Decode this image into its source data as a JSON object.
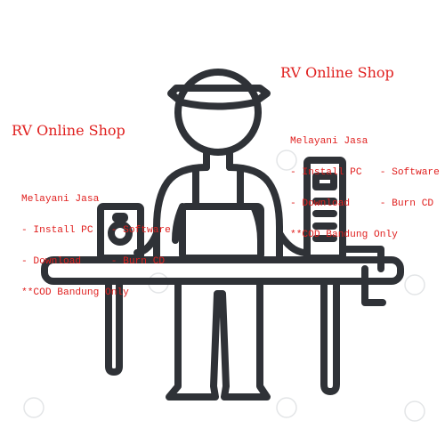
{
  "illustration": {
    "subject": "person-at-desk-icon",
    "stroke_color": "#2f3237",
    "background_color": "#ffffff"
  },
  "ads": [
    {
      "title": "RV Online Shop",
      "lines": [
        "Melayani Jasa",
        "- Install PC   - Software",
        "- Download     - Burn CD",
        "**COD Bandung Only"
      ],
      "color": "#e0201f"
    },
    {
      "title": "RV Online Shop",
      "lines": [
        "Melayani Jasa",
        "- Install PC   - Software",
        "- Download     - Burn CD",
        "**COD Bandung Only"
      ],
      "color": "#e0201f"
    }
  ],
  "watermark_color": "#d9dbdd"
}
